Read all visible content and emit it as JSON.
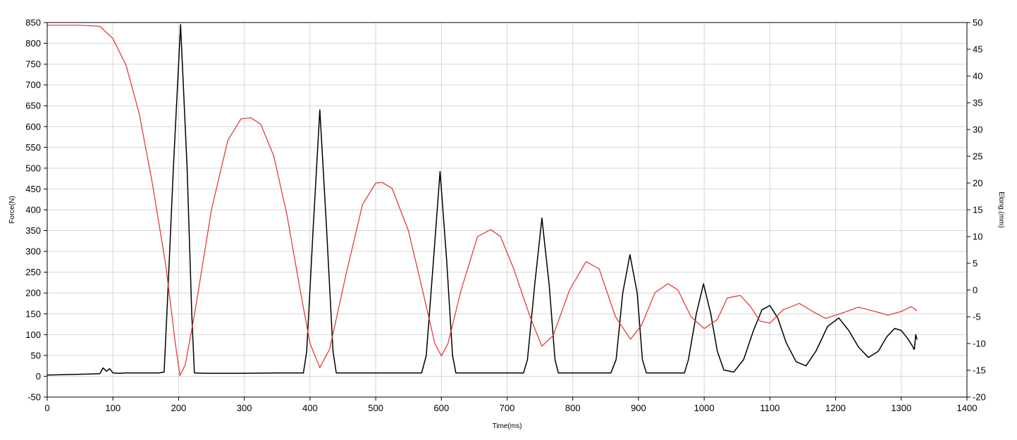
{
  "chart_data": {
    "type": "line",
    "xlabel": "Time(ms)",
    "ylabel_left": "Force(N)",
    "ylabel_right": "Elong.(mm)",
    "xlim": [
      0,
      1400
    ],
    "ylim_left": [
      -50,
      850
    ],
    "ylim_right": [
      -20,
      50
    ],
    "x_ticks": [
      0,
      100,
      200,
      300,
      400,
      500,
      600,
      700,
      800,
      900,
      1000,
      1100,
      1200,
      1300,
      1400
    ],
    "y_left_ticks": [
      -50,
      0,
      50,
      100,
      150,
      200,
      250,
      300,
      350,
      400,
      450,
      500,
      550,
      600,
      650,
      700,
      750,
      800,
      850
    ],
    "y_right_ticks": [
      -20,
      -15,
      -10,
      -5,
      0,
      5,
      10,
      15,
      20,
      25,
      30,
      35,
      40,
      45,
      50
    ],
    "grid": true,
    "series": [
      {
        "axis": "left",
        "color": "#000000",
        "x": [
          0,
          80,
          85,
          90,
          95,
          100,
          110,
          120,
          130,
          140,
          150,
          160,
          170,
          178,
          183,
          192,
          203,
          213,
          220,
          224,
          240,
          300,
          350,
          390,
          395,
          405,
          415,
          425,
          435,
          440,
          500,
          570,
          577,
          588,
          598,
          608,
          617,
          622,
          680,
          725,
          731,
          742,
          753,
          764,
          773,
          778,
          840,
          858,
          866,
          876,
          887,
          898,
          906,
          912,
          970,
          976,
          988,
          999,
          1010,
          1020,
          1030,
          1045,
          1060,
          1075,
          1088,
          1100,
          1112,
          1125,
          1140,
          1155,
          1170,
          1188,
          1205,
          1220,
          1235,
          1250,
          1265,
          1278,
          1290,
          1300,
          1310,
          1318,
          1319,
          1320,
          1322,
          1324
        ],
        "y": [
          3,
          6,
          20,
          12,
          18,
          8,
          7,
          8,
          8,
          8,
          8,
          8,
          8,
          10,
          180,
          500,
          845,
          500,
          150,
          8,
          7,
          7,
          8,
          8,
          60,
          360,
          640,
          360,
          60,
          8,
          8,
          8,
          50,
          280,
          492,
          280,
          50,
          8,
          8,
          8,
          40,
          220,
          380,
          220,
          40,
          8,
          8,
          8,
          40,
          200,
          292,
          200,
          40,
          8,
          8,
          40,
          150,
          222,
          150,
          60,
          15,
          10,
          40,
          110,
          160,
          170,
          140,
          80,
          35,
          25,
          60,
          120,
          140,
          110,
          70,
          45,
          60,
          95,
          115,
          110,
          90,
          70,
          65,
          65,
          100,
          88
        ]
      },
      {
        "axis": "right",
        "color": "#e03030",
        "x": [
          0,
          50,
          80,
          100,
          120,
          140,
          160,
          180,
          195,
          202,
          210,
          225,
          250,
          275,
          295,
          310,
          325,
          345,
          365,
          385,
          400,
          415,
          430,
          455,
          480,
          500,
          510,
          525,
          550,
          575,
          590,
          600,
          610,
          630,
          655,
          675,
          690,
          710,
          735,
          753,
          770,
          795,
          820,
          840,
          865,
          888,
          905,
          925,
          945,
          960,
          980,
          1000,
          1020,
          1035,
          1055,
          1070,
          1085,
          1100,
          1120,
          1145,
          1165,
          1185,
          1210,
          1235,
          1260,
          1280,
          1300,
          1315,
          1320,
          1324
        ],
        "y": [
          49.5,
          49.5,
          49.3,
          47,
          42,
          33,
          20,
          5,
          -10,
          -16,
          -14,
          -4,
          15,
          28,
          32,
          32.2,
          31,
          25,
          14,
          0,
          -10,
          -14.5,
          -11,
          3,
          16,
          20,
          20.1,
          19,
          11,
          -2,
          -10,
          -12.3,
          -10,
          0,
          10,
          11.3,
          10,
          4,
          -5,
          -10.5,
          -8.5,
          0,
          5.3,
          4,
          -5,
          -9.2,
          -6.5,
          -0.5,
          1.2,
          0,
          -5,
          -7.2,
          -5.5,
          -1.5,
          -1,
          -3,
          -5.8,
          -6.2,
          -3.7,
          -2.5,
          -4,
          -5.3,
          -4.3,
          -3.2,
          -4,
          -4.7,
          -4,
          -3.1,
          -3.5,
          -3.9
        ]
      }
    ]
  }
}
